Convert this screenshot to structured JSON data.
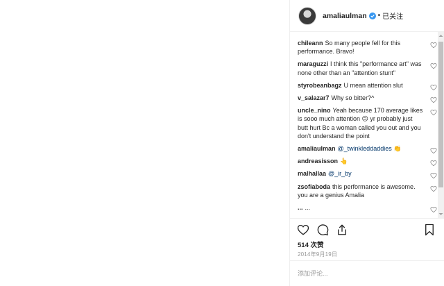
{
  "header": {
    "username": "amaliaulman",
    "separator": "•",
    "follow_label": "已关注"
  },
  "comments": [
    {
      "user": "chileann",
      "text": "So many people fell for this performance. Bravo!"
    },
    {
      "user": "maraguzzi",
      "text": "I think this \"performance art\" was none other than an \"attention stunt\""
    },
    {
      "user": "styrobeanbagz",
      "text": "U mean attention slut"
    },
    {
      "user": "v_salazar7",
      "text": "Why so bitter?^"
    },
    {
      "user": "uncle_nino",
      "text": "Yeah because 170 average likes is sooo much attention 😉 yr probably just butt hurt Bc a woman called you out and you don't understand the point"
    },
    {
      "user": "amaliaulman",
      "mention": "@_twinkleddaddies",
      "text": " 👏"
    },
    {
      "user": "andreasisson",
      "text": "👆"
    },
    {
      "user": "malhallaa",
      "mention": "@_ir_by",
      "text": ""
    },
    {
      "user": "zsofiaboda",
      "text": "this performance is awesome. you are a genius Amalia"
    },
    {
      "user": "...",
      "text": "..."
    }
  ],
  "actions": {
    "likes": "514 次赞",
    "date": "2014年9月19日"
  },
  "add_comment": {
    "placeholder": "添加评论..."
  },
  "icons": [
    "verified-badge-icon",
    "heart-icon",
    "comment-icon",
    "share-icon",
    "bookmark-icon"
  ],
  "colors": {
    "verified": "#3897f0",
    "mention": "#003569",
    "muted": "#999999",
    "border": "#efefef"
  }
}
